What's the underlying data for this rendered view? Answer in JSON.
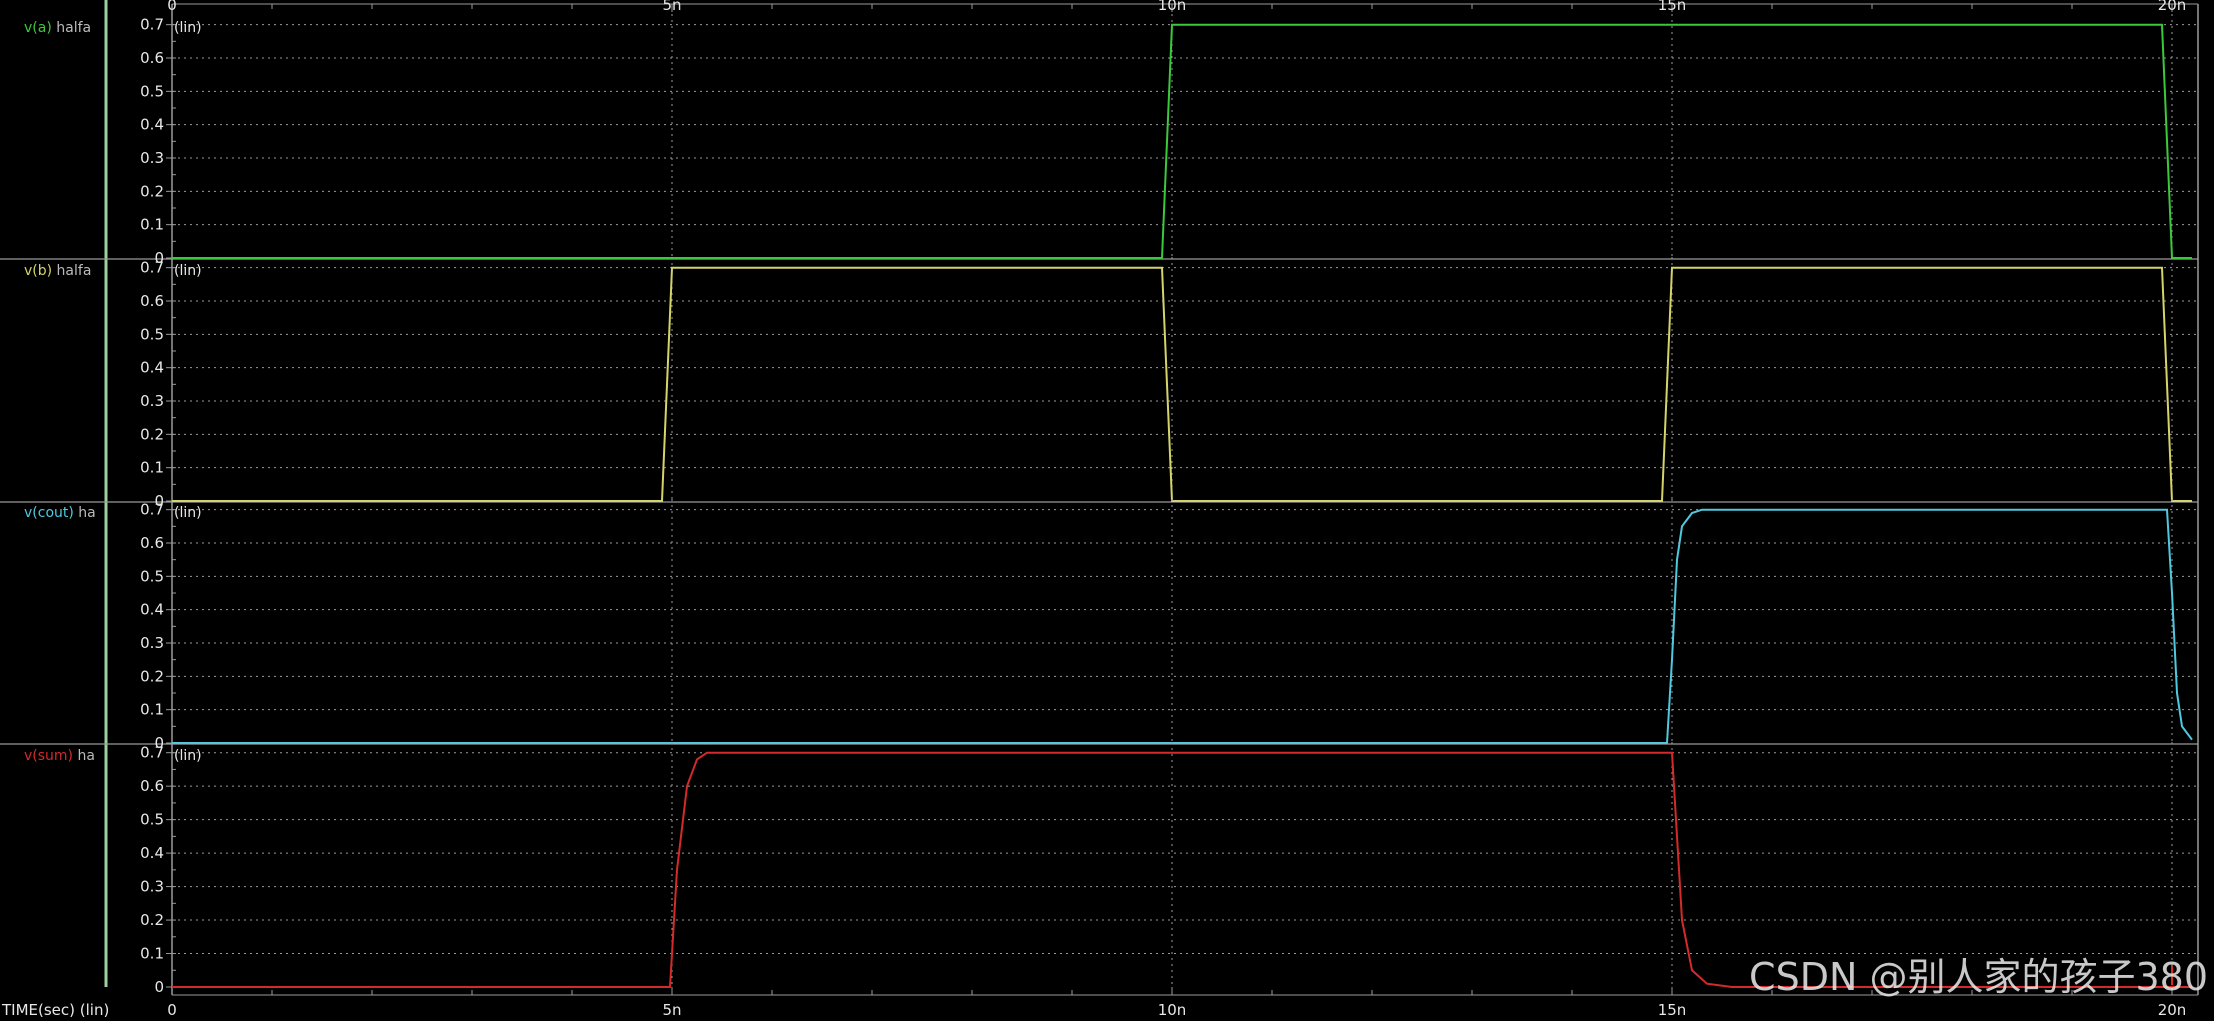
{
  "time_axis": {
    "label": "TIME(sec) (lin)",
    "ticks": [
      "0",
      "5n",
      "10n",
      "15n",
      "20n"
    ],
    "tick_values_ns": [
      0,
      5,
      10,
      15,
      20
    ],
    "range_ns": [
      0,
      20.2
    ]
  },
  "panels": [
    {
      "name": "v(a)",
      "suffix": "halfa",
      "color": "#3cc83c",
      "scale": "(lin)"
    },
    {
      "name": "v(b)",
      "suffix": "halfa",
      "color": "#d4d46a",
      "scale": "(lin)"
    },
    {
      "name": "v(cout)",
      "suffix": "ha",
      "color": "#4fc8e0",
      "scale": "(lin)"
    },
    {
      "name": "v(sum)",
      "suffix": "ha",
      "color": "#d42a2a",
      "scale": "(lin)"
    }
  ],
  "y_ticks": [
    "0.7",
    "0.6",
    "0.5",
    "0.4",
    "0.3",
    "0.2",
    "0.1",
    "0"
  ],
  "watermark": "CSDN @别人家的孩子380",
  "chart_data": [
    {
      "type": "line",
      "title": "v(a)",
      "xlabel": "TIME(sec) (lin)",
      "ylabel": "(lin)",
      "ylim": [
        0,
        0.72
      ],
      "grid": true,
      "series": [
        {
          "name": "v(a)",
          "x_ns": [
            0,
            9.9,
            10.0,
            19.9,
            20.0,
            20.2
          ],
          "y": [
            0,
            0,
            0.7,
            0.7,
            0,
            0
          ]
        }
      ]
    },
    {
      "type": "line",
      "title": "v(b)",
      "xlabel": "TIME(sec) (lin)",
      "ylabel": "(lin)",
      "ylim": [
        0,
        0.72
      ],
      "grid": true,
      "series": [
        {
          "name": "v(b)",
          "x_ns": [
            0,
            4.9,
            5.0,
            9.9,
            10.0,
            14.9,
            15.0,
            19.9,
            20.0,
            20.2
          ],
          "y": [
            0,
            0,
            0.7,
            0.7,
            0,
            0,
            0.7,
            0.7,
            0,
            0
          ]
        }
      ]
    },
    {
      "type": "line",
      "title": "v(cout)",
      "xlabel": "TIME(sec) (lin)",
      "ylabel": "(lin)",
      "ylim": [
        0,
        0.72
      ],
      "grid": true,
      "series": [
        {
          "name": "v(cout)",
          "x_ns": [
            0,
            14.95,
            15.0,
            15.05,
            15.1,
            15.2,
            15.3,
            19.95,
            20.0,
            20.05,
            20.1,
            20.2
          ],
          "y": [
            0,
            0,
            0.25,
            0.55,
            0.65,
            0.69,
            0.7,
            0.7,
            0.45,
            0.15,
            0.05,
            0.01
          ]
        }
      ]
    },
    {
      "type": "line",
      "title": "v(sum)",
      "xlabel": "TIME(sec) (lin)",
      "ylabel": "(lin)",
      "ylim": [
        0,
        0.72
      ],
      "grid": true,
      "series": [
        {
          "name": "v(sum)",
          "x_ns": [
            0,
            4.98,
            5.05,
            5.15,
            5.25,
            5.35,
            15.0,
            15.05,
            15.1,
            15.2,
            15.35,
            15.6,
            20.2
          ],
          "y": [
            0,
            0,
            0.35,
            0.6,
            0.68,
            0.7,
            0.7,
            0.45,
            0.2,
            0.05,
            0.01,
            0,
            0
          ]
        }
      ]
    }
  ]
}
